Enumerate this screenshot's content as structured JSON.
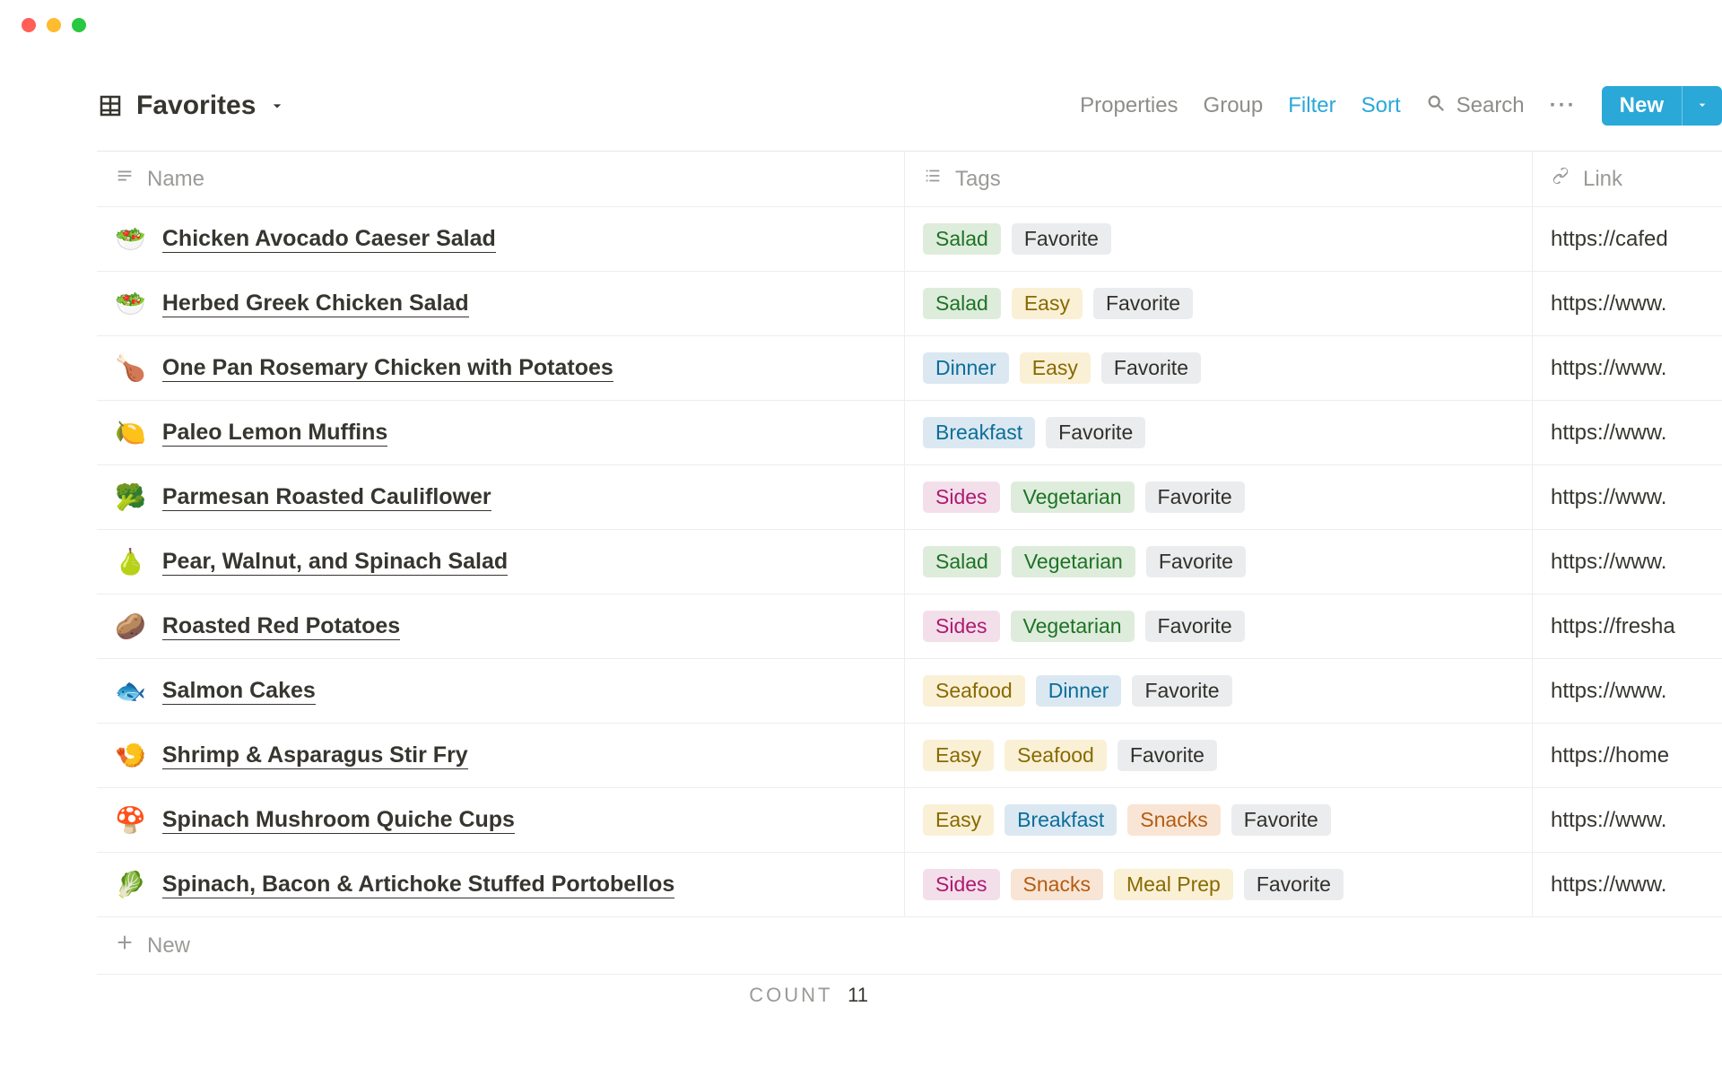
{
  "window": {
    "traffic_lights": true
  },
  "view": {
    "name": "Favorites"
  },
  "toolbar": {
    "properties": "Properties",
    "group": "Group",
    "filter": "Filter",
    "sort": "Sort",
    "search": "Search",
    "more": "···",
    "new": "New"
  },
  "columns": {
    "name": "Name",
    "tags": "Tags",
    "link": "Link"
  },
  "tag_colors": {
    "Salad": "green",
    "Favorite": "default",
    "Easy": "yellow",
    "Dinner": "blue",
    "Breakfast": "blue",
    "Sides": "pink",
    "Vegetarian": "green",
    "Seafood": "yellow",
    "Snacks": "orange",
    "Meal Prep": "yellow"
  },
  "rows": [
    {
      "icon": "🥗",
      "title": "Chicken Avocado Caeser Salad",
      "tags": [
        "Salad",
        "Favorite"
      ],
      "link": "https://cafed"
    },
    {
      "icon": "🥗",
      "title": "Herbed Greek Chicken Salad",
      "tags": [
        "Salad",
        "Easy",
        "Favorite"
      ],
      "link": "https://www."
    },
    {
      "icon": "🍗",
      "title": "One Pan Rosemary Chicken with Potatoes",
      "tags": [
        "Dinner",
        "Easy",
        "Favorite"
      ],
      "link": "https://www."
    },
    {
      "icon": "🍋",
      "title": "Paleo Lemon Muffins",
      "tags": [
        "Breakfast",
        "Favorite"
      ],
      "link": "https://www."
    },
    {
      "icon": "🥦",
      "title": "Parmesan Roasted Cauliflower",
      "tags": [
        "Sides",
        "Vegetarian",
        "Favorite"
      ],
      "link": "https://www."
    },
    {
      "icon": "🍐",
      "title": "Pear, Walnut, and Spinach Salad",
      "tags": [
        "Salad",
        "Vegetarian",
        "Favorite"
      ],
      "link": "https://www."
    },
    {
      "icon": "🥔",
      "title": "Roasted Red Potatoes",
      "tags": [
        "Sides",
        "Vegetarian",
        "Favorite"
      ],
      "link": "https://fresha"
    },
    {
      "icon": "🐟",
      "title": "Salmon Cakes",
      "tags": [
        "Seafood",
        "Dinner",
        "Favorite"
      ],
      "link": "https://www."
    },
    {
      "icon": "🍤",
      "title": "Shrimp & Asparagus Stir Fry",
      "tags": [
        "Easy",
        "Seafood",
        "Favorite"
      ],
      "link": "https://home"
    },
    {
      "icon": "🍄",
      "title": "Spinach Mushroom Quiche Cups",
      "tags": [
        "Easy",
        "Breakfast",
        "Snacks",
        "Favorite"
      ],
      "link": "https://www."
    },
    {
      "icon": "🥬",
      "title": "Spinach, Bacon & Artichoke Stuffed Portobellos",
      "tags": [
        "Sides",
        "Snacks",
        "Meal Prep",
        "Favorite"
      ],
      "link": "https://www."
    }
  ],
  "footer": {
    "count_label": "COUNT",
    "count_value": "11",
    "new_row": "New"
  }
}
